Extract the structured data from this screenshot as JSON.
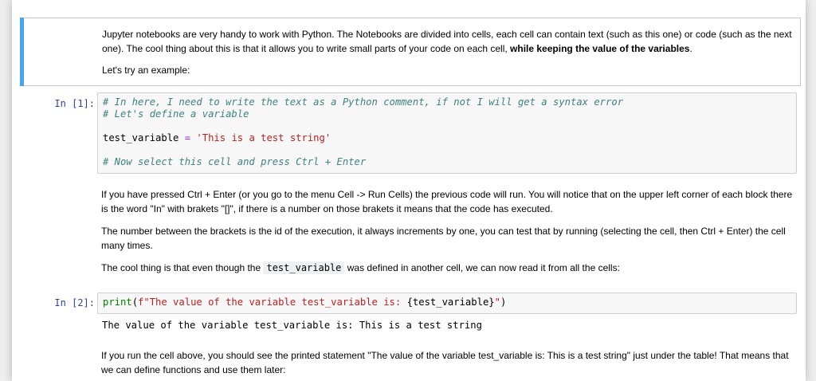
{
  "md1": {
    "p1_part1": "Jupyter notebooks are very handy to work with Python. The Notebooks are divided into cells, each cell can contain text (such as this one) or code (such as the next one). The cool thing about this is that it allows you to write small parts of your code on each cell, ",
    "p1_bold": "while keeping the value of the variables",
    "p1_end": ".",
    "p2": "Let's try an example:"
  },
  "cell1": {
    "prompt": "In [1]:",
    "line1": "# In here, I need to write the text as a Python comment, if not I will get a syntax error",
    "line2": "# Let's define a variable",
    "line4_var": "test_variable",
    "line4_op": "=",
    "line4_str": "'This is a test string'",
    "line6": "# Now select this cell and press Ctrl + Enter"
  },
  "md2": {
    "p1": "If you have pressed Ctrl + Enter (or you go to the menu Cell -> Run Cells) the previous code will run. You will notice that on the upper left corner of each block there is the word \"In\" with brakets \"[]\", if there is a number on those brakets it means that the code has executed.",
    "p2": "The number between the brackets is the id of the execution, it always increments by one, you can test that by running (selecting the cell, then Ctrl + Enter) the cell many times.",
    "p3_before": "The cool thing is that even though the ",
    "p3_code": "test_variable",
    "p3_after": " was defined in another cell, we can now read it from all the cells:"
  },
  "cell2": {
    "prompt": "In [2]:",
    "code_builtin": "print",
    "code_open": "(",
    "code_str": "f\"The value of the variable test_variable is: ",
    "code_interp": "{test_variable}",
    "code_str_end": "\"",
    "code_close": ")",
    "output": "The value of the variable test_variable is: This is a test string"
  },
  "md3": {
    "p1": "If you run the cell above, you should see the printed statement \"The value of the variable test_variable is: This is a test string\" just under the table! That means that we can define functions and use them later:"
  }
}
